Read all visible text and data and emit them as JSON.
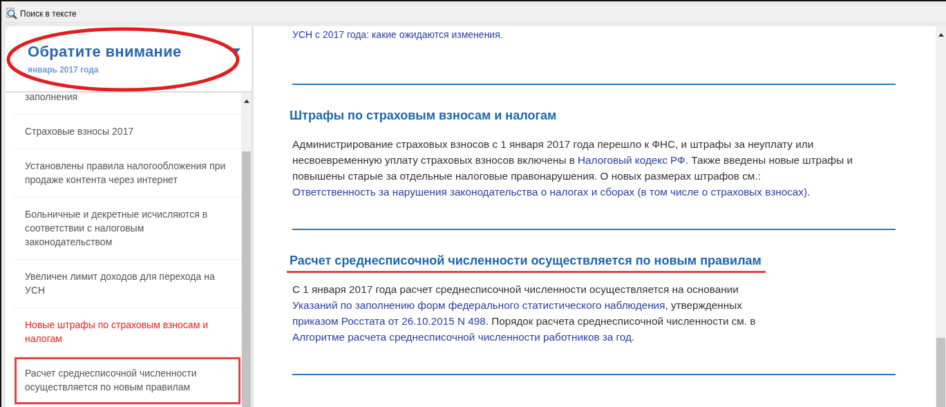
{
  "toolbar": {
    "label": "Поиск в тексте"
  },
  "sidebar": {
    "title": "Обратите внимание",
    "subtitle": "январь 2017 года",
    "annotated": true,
    "items": [
      {
        "text": "заполнения",
        "selected": false,
        "annotated": false
      },
      {
        "text": "Страховые взносы 2017",
        "selected": false,
        "annotated": false
      },
      {
        "text": "Установлены правила налогообложения при продаже контента через интернет",
        "selected": false,
        "annotated": false
      },
      {
        "text": "Больничные и декретные исчисляются в соответствии с налоговым законодательством",
        "selected": false,
        "annotated": false
      },
      {
        "text": "Увеличен лимит доходов для перехода на УСН",
        "selected": false,
        "annotated": false
      },
      {
        "text": "Новые штрафы по страховым взносам и налогам",
        "selected": true,
        "annotated": false
      },
      {
        "text": "Расчет среднесписочной численности осуществляется по новым правилам",
        "selected": false,
        "annotated": true
      }
    ]
  },
  "top_link": "УСН с 2017 года: какие ожидаются изменения.",
  "sections": [
    {
      "heading": "Штрафы по страховым взносам и налогам",
      "annotated": false,
      "paragraph": [
        {
          "text": "Администрирование страховых взносов с 1 января 2017 года перешло к ФНС, и штрафы за неуплату или несвоевременную уплату страховых взносов включены в ",
          "kind": "text"
        },
        {
          "text": "Налоговый кодекс РФ",
          "kind": "link"
        },
        {
          "text": ". Также введены новые штрафы и повышены старые за отдельные налоговые правонарушения. О новых размерах штрафов см.: ",
          "kind": "text"
        },
        {
          "text": "Ответственность за нарушения законодательства о налогах и сборах (в том числе о страховых взносах)",
          "kind": "link"
        },
        {
          "text": ".",
          "kind": "text"
        }
      ]
    },
    {
      "heading": "Расчет среднесписочной численности осуществляется по новым правилам",
      "annotated": true,
      "paragraph": [
        {
          "text": "С 1 января 2017 года расчет среднесписочной численности осуществляется на основании ",
          "kind": "text"
        },
        {
          "text": "Указаний по заполнению форм федерального статистического наблюдения",
          "kind": "link"
        },
        {
          "text": ", утвержденных ",
          "kind": "text"
        },
        {
          "text": "приказом Росстата от 26.10.2015 N 498",
          "kind": "link"
        },
        {
          "text": ". Порядок расчета среднесписочной численности см. в ",
          "kind": "text"
        },
        {
          "text": "Алгоритме расчета среднесписочной численности работников за год",
          "kind": "link"
        },
        {
          "text": ".",
          "kind": "text"
        }
      ]
    }
  ]
}
